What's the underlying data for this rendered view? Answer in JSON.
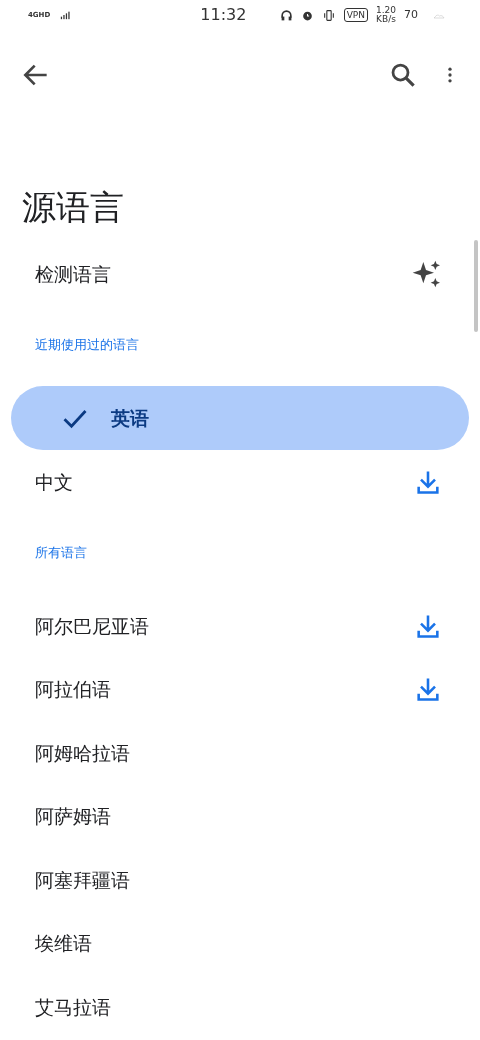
{
  "status_bar": {
    "network": "4GHD",
    "time": "11:32",
    "vpn": "VPN",
    "speed": "1.20",
    "speed_unit": "KB/s",
    "battery": "70"
  },
  "title": "源语言",
  "detect": {
    "label": "检测语言"
  },
  "sections": [
    {
      "heading": "近期使用过的语言",
      "items": [
        {
          "label": "英语",
          "selected": true,
          "downloadable": false
        },
        {
          "label": "中文",
          "selected": false,
          "downloadable": true
        }
      ]
    },
    {
      "heading": "所有语言",
      "items": [
        {
          "label": "阿尔巴尼亚语",
          "selected": false,
          "downloadable": true
        },
        {
          "label": "阿拉伯语",
          "selected": false,
          "downloadable": true
        },
        {
          "label": "阿姆哈拉语",
          "selected": false,
          "downloadable": false
        },
        {
          "label": "阿萨姆语",
          "selected": false,
          "downloadable": false
        },
        {
          "label": "阿塞拜疆语",
          "selected": false,
          "downloadable": false
        },
        {
          "label": "埃维语",
          "selected": false,
          "downloadable": false
        },
        {
          "label": "艾马拉语",
          "selected": false,
          "downloadable": false
        }
      ]
    }
  ]
}
